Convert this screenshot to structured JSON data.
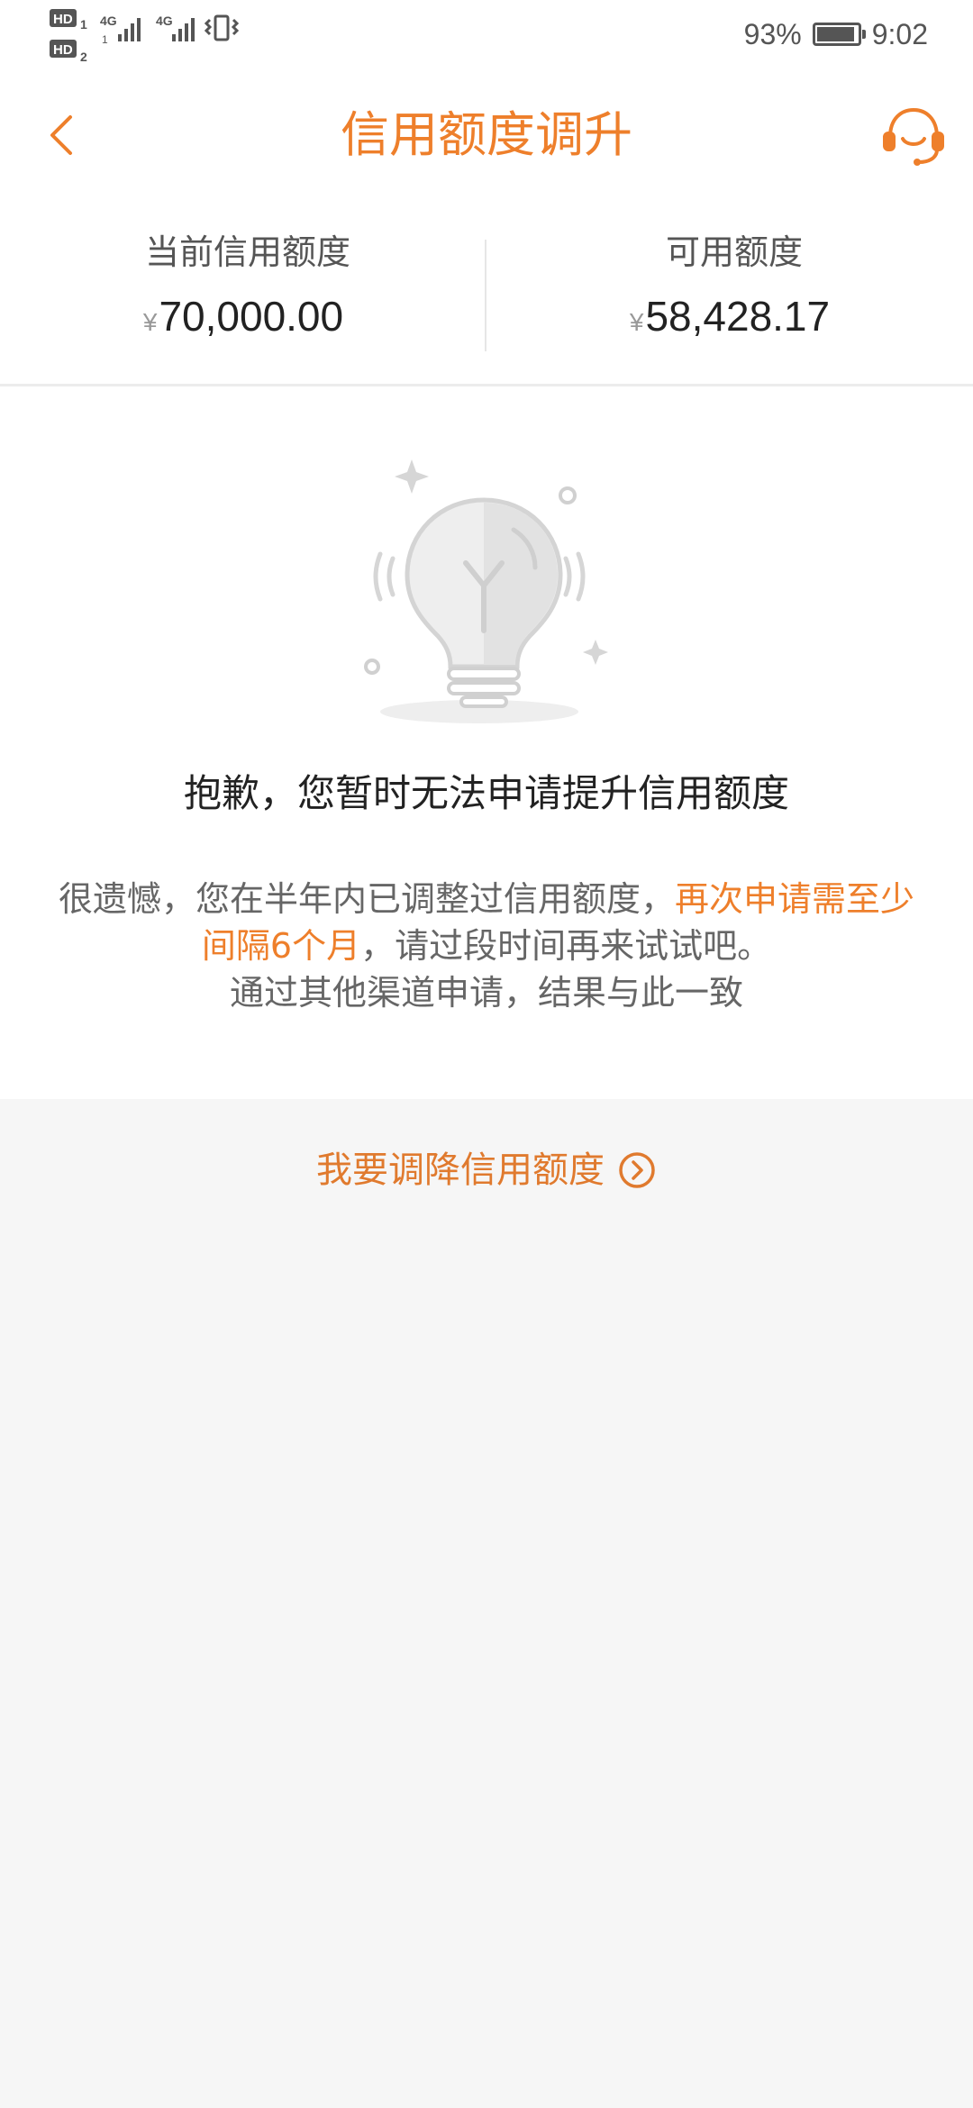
{
  "status_bar": {
    "left_icons": [
      "hd-1-icon",
      "hd-2-icon",
      "signal-4g-1-icon",
      "signal-4g-2-icon",
      "vibrate-icon"
    ],
    "labels": {
      "hd": "HD",
      "net": "4G"
    },
    "battery_percent": "93%",
    "battery_level": 0.93,
    "time": "9:02"
  },
  "header": {
    "title": "信用额度调升",
    "back_icon": "chevron-left-icon",
    "service_icon": "customer-service-icon",
    "accent_color": "#ee7f2b"
  },
  "summary": {
    "current": {
      "label": "当前信用额度",
      "currency": "¥",
      "value": "70,000.00"
    },
    "available": {
      "label": "可用额度",
      "currency": "¥",
      "value": "58,428.17"
    }
  },
  "illustration": {
    "icon": "lightbulb-icon"
  },
  "message": {
    "title": "抱歉，您暂时无法申请提升信用额度",
    "body_part1": "很遗憾，您在半年内已调整过信用额度，",
    "body_highlight": "再次申请需至少间隔6个月",
    "body_part2": "，请过段时间再来试试吧。",
    "body_line3": "通过其他渠道申请，结果与此一致"
  },
  "reduce_link": {
    "label": "我要调降信用额度",
    "icon": "circle-chevron-right-icon"
  }
}
